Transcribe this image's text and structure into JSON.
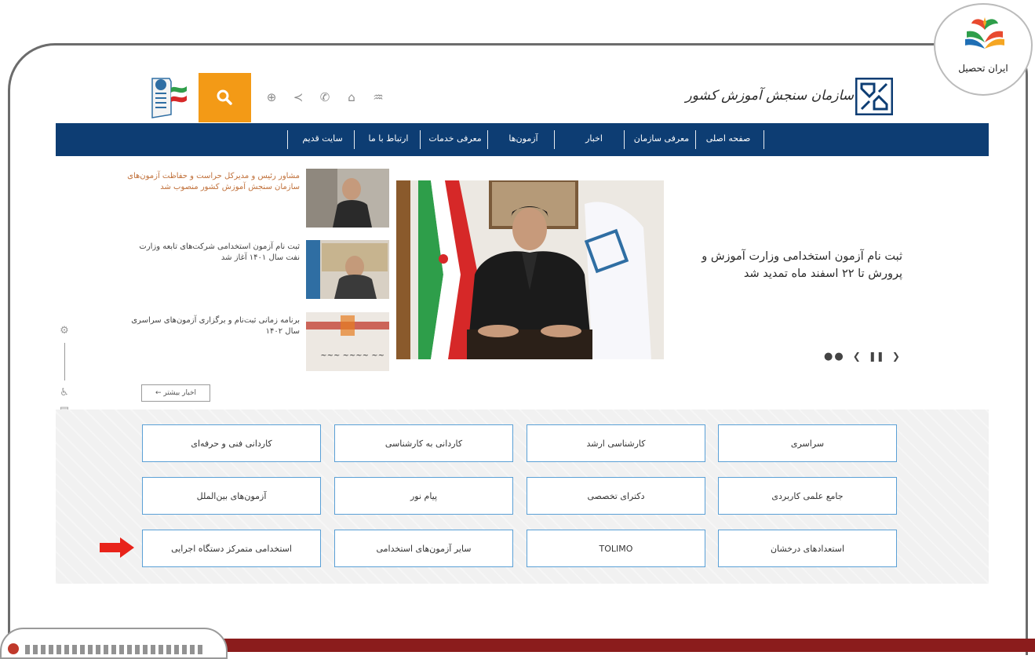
{
  "brand": {
    "name": "ایران تحصیل"
  },
  "header": {
    "org_title": "سازمان سنجش آموزش کشور"
  },
  "nav": {
    "items": [
      {
        "label": "صفحه اصلی"
      },
      {
        "label": "معرفی سازمان"
      },
      {
        "label": "اخبار"
      },
      {
        "label": "آزمون‌ها"
      },
      {
        "label": "معرفی خدمات"
      },
      {
        "label": "ارتباط با ما"
      },
      {
        "label": "سایت قدیم"
      }
    ]
  },
  "hero": {
    "caption": "ثبت نام آزمون استخدامی وزارت آموزش و پرورش تا ۲۲ اسفند ماه تمدید شد"
  },
  "news": [
    {
      "title": "مشاور رئیس و مدیرکل حراست و حفاظت آزمون‌های سازمان سنجش آموزش کشور منصوب شد"
    },
    {
      "title": "ثبت نام آزمون استخدامی شرکت‌های تابعه وزارت نفت سال ۱۴۰۱ آغاز شد"
    },
    {
      "title": "برنامه زمانی ثبت‌نام و برگزاری آزمون‌های سراسری سال ۱۴۰۲"
    }
  ],
  "more_news_label": "اخبار بیشتر ←",
  "exams": {
    "row1": [
      "سراسری",
      "کارشناسی ارشد",
      "کاردانی به کارشناسی",
      "کاردانی فنی و حرفه‌ای"
    ],
    "row2": [
      "جامع علمی کاربردی",
      "دکترای تخصصی",
      "پیام نور",
      "آزمون‌های بین‌الملل"
    ],
    "row3": [
      "استعدادهای درخشان",
      "TOLIMO",
      "سایر آزمون‌های استخدامی",
      "استخدامی متمرکز دستگاه اجرایی"
    ]
  },
  "colors": {
    "nav_bg": "#0d3d73",
    "search_bg": "#f39a16",
    "button_border": "#5aa0d6",
    "arrow": "#e8231a"
  },
  "icons": [
    "search-icon",
    "globe-icon",
    "share-icon",
    "phone-icon",
    "home-icon",
    "rss-icon",
    "settings-icon",
    "accessibility-icon"
  ]
}
